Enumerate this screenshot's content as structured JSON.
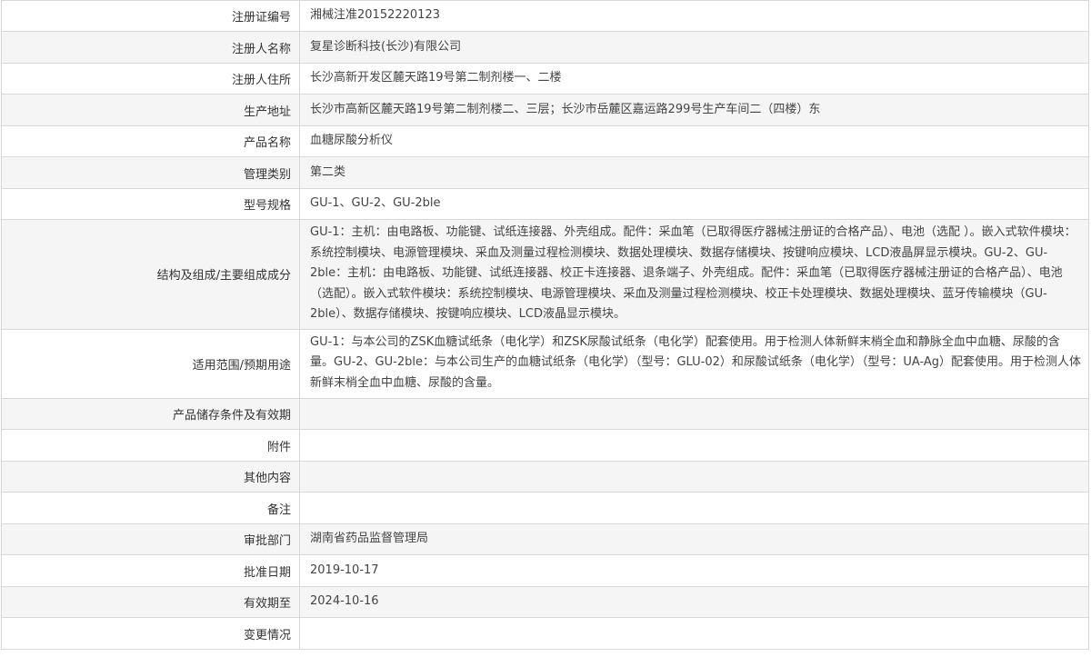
{
  "rows": [
    {
      "label": "注册证编号",
      "value": "湘械注准20152220123"
    },
    {
      "label": "注册人名称",
      "value": "复星诊断科技(长沙)有限公司"
    },
    {
      "label": "注册人住所",
      "value": "长沙高新开发区麓天路19号第二制剂楼一、二楼"
    },
    {
      "label": "生产地址",
      "value": "长沙市高新区麓天路19号第二制剂楼二、三层；长沙市岳麓区嘉运路299号生产车间二（四楼）东"
    },
    {
      "label": "产品名称",
      "value": "血糖尿酸分析仪"
    },
    {
      "label": "管理类别",
      "value": "第二类"
    },
    {
      "label": "型号规格",
      "value": "GU-1、GU-2、GU-2ble"
    },
    {
      "label": "结构及组成/主要组成成分",
      "value": "GU-1：主机：由电路板、功能键、试纸连接器、外壳组成。配件：采血笔（已取得医疗器械注册证的合格产品）、电池（选配 ）。嵌入式软件模块：系统控制模块、电源管理模块、采血及测量过程检测模块、数据处理模块、数据存储模块、按键响应模块、LCD液晶屏显示模块。GU-2、GU-2ble：主机：由电路板、功能键、试纸连接器、校正卡连接器、退条端子、外壳组成。配件：采血笔（已取得医疗器械注册证的合格产品）、电池（选配）。嵌入式软件模块：系统控制模块、电源管理模块、采血及测量过程检测模块、校正卡处理模块、数据处理模块、蓝牙传输模块（GU-2ble）、数据存储模块、按键响应模块、LCD液晶显示模块。"
    },
    {
      "label": "适用范围/预期用途",
      "value": "GU-1：与本公司的ZSK血糖试纸条（电化学）和ZSK尿酸试纸条（电化学）配套使用。用于检测人体新鲜末梢全血和静脉全血中血糖、尿酸的含量。GU-2、GU-2ble：与本公司生产的血糖试纸条（电化学）（型号：GLU-02）和尿酸试纸条（电化学）（型号：UA-Ag）配套使用。用于检测人体新鲜末梢全血中血糖、尿酸的含量。"
    },
    {
      "label": "产品储存条件及有效期",
      "value": ""
    },
    {
      "label": "附件",
      "value": ""
    },
    {
      "label": "其他内容",
      "value": ""
    },
    {
      "label": "备注",
      "value": ""
    },
    {
      "label": "审批部门",
      "value": "湖南省药品监督管理局"
    },
    {
      "label": "批准日期",
      "value": "2019-10-17"
    },
    {
      "label": "有效期至",
      "value": "2024-10-16"
    },
    {
      "label": "变更情况",
      "value": ""
    }
  ]
}
